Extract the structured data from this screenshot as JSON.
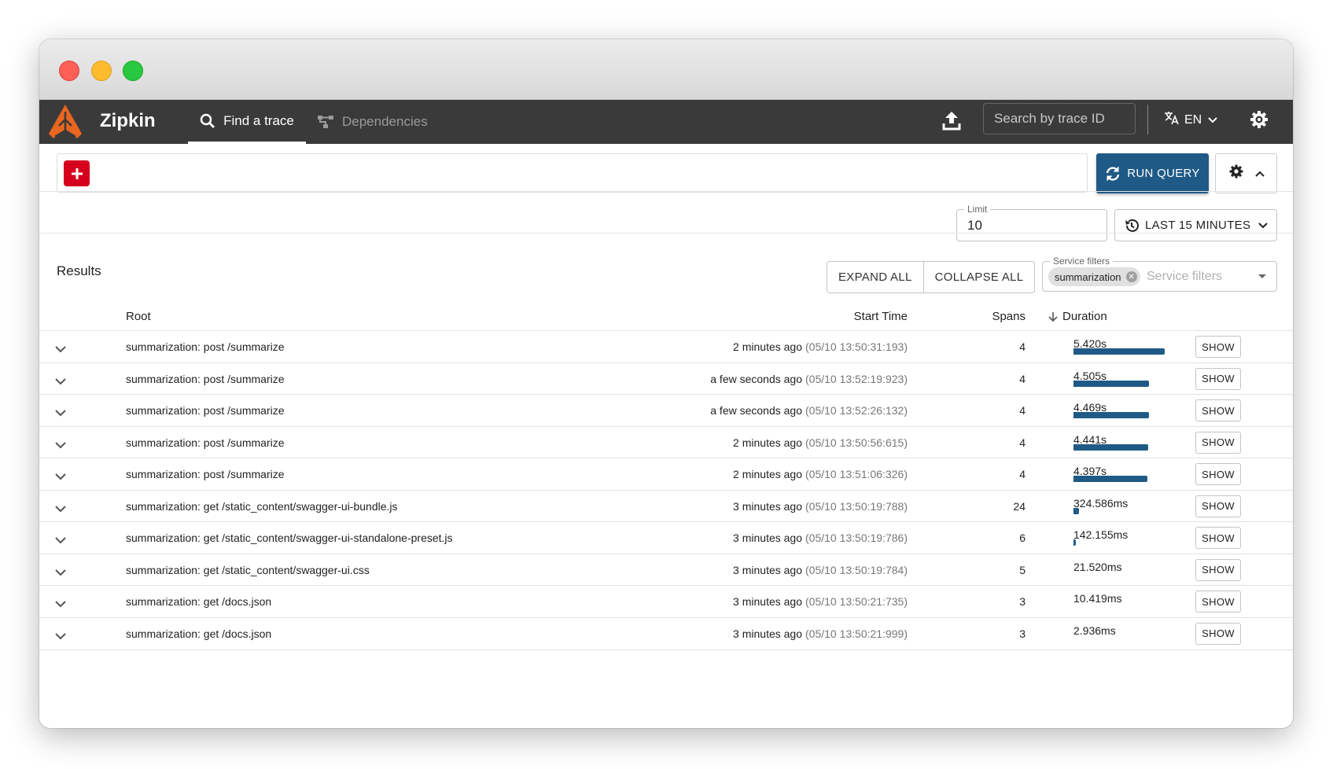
{
  "app": {
    "brand": "Zipkin",
    "nav": {
      "find_trace": "Find a trace",
      "dependencies": "Dependencies"
    },
    "search_placeholder": "Search by trace ID",
    "language": "EN"
  },
  "query": {
    "run_label": "RUN QUERY",
    "limit_label": "Limit",
    "limit_value": "10",
    "range_label": "LAST 15 MINUTES"
  },
  "results": {
    "title": "Results",
    "expand_all": "EXPAND ALL",
    "collapse_all": "COLLAPSE ALL",
    "service_filters_label": "Service filters",
    "service_filters_placeholder": "Service filters",
    "service_chip": "summarization",
    "columns": {
      "root": "Root",
      "start": "Start Time",
      "spans": "Spans",
      "duration": "Duration"
    },
    "show_label": "SHOW",
    "rows": [
      {
        "root": "summarization: post /summarize",
        "rel": "2 minutes ago",
        "abs": "(05/10 13:50:31:193)",
        "spans": "4",
        "duration": "5.420s",
        "pct": 1.0
      },
      {
        "root": "summarization: post /summarize",
        "rel": "a few seconds ago",
        "abs": "(05/10 13:52:19:923)",
        "spans": "4",
        "duration": "4.505s",
        "pct": 0.831
      },
      {
        "root": "summarization: post /summarize",
        "rel": "a few seconds ago",
        "abs": "(05/10 13:52:26:132)",
        "spans": "4",
        "duration": "4.469s",
        "pct": 0.825
      },
      {
        "root": "summarization: post /summarize",
        "rel": "2 minutes ago",
        "abs": "(05/10 13:50:56:615)",
        "spans": "4",
        "duration": "4.441s",
        "pct": 0.819
      },
      {
        "root": "summarization: post /summarize",
        "rel": "2 minutes ago",
        "abs": "(05/10 13:51:06:326)",
        "spans": "4",
        "duration": "4.397s",
        "pct": 0.811
      },
      {
        "root": "summarization: get /static_content/swagger-ui-bundle.js",
        "rel": "3 minutes ago",
        "abs": "(05/10 13:50:19:788)",
        "spans": "24",
        "duration": "324.586ms",
        "pct": 0.06
      },
      {
        "root": "summarization: get /static_content/swagger-ui-standalone-preset.js",
        "rel": "3 minutes ago",
        "abs": "(05/10 13:50:19:786)",
        "spans": "6",
        "duration": "142.155ms",
        "pct": 0.026
      },
      {
        "root": "summarization: get /static_content/swagger-ui.css",
        "rel": "3 minutes ago",
        "abs": "(05/10 13:50:19:784)",
        "spans": "5",
        "duration": "21.520ms",
        "pct": 0.004
      },
      {
        "root": "summarization: get /docs.json",
        "rel": "3 minutes ago",
        "abs": "(05/10 13:50:21:735)",
        "spans": "3",
        "duration": "10.419ms",
        "pct": 0.002
      },
      {
        "root": "summarization: get /docs.json",
        "rel": "3 minutes ago",
        "abs": "(05/10 13:50:21:999)",
        "spans": "3",
        "duration": "2.936ms",
        "pct": 0.001
      }
    ]
  },
  "colors": {
    "topbar": "#3a3a3a",
    "accent": "#1f5a86",
    "add": "#d6001c",
    "logo": "#e8661f"
  }
}
